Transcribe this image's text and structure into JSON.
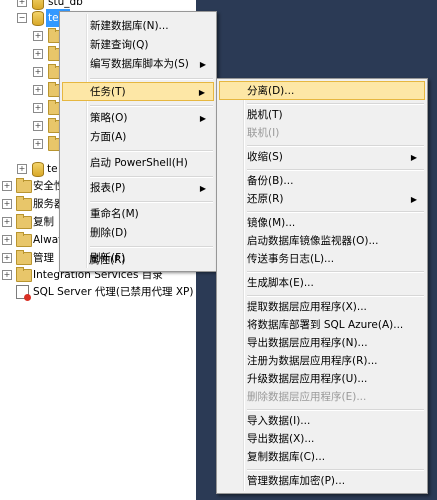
{
  "explorer": {
    "top_db": "stu_db",
    "selected_db": "test",
    "second_db": "te",
    "top_folders": [
      "安全性",
      "服务器",
      "复制",
      "Always",
      "管理",
      "Integration Services 目录"
    ],
    "agent": "SQL Server 代理(已禁用代理 XP)"
  },
  "context_menu": {
    "items": [
      {
        "label": "新建数据库(N)...",
        "arrow": false
      },
      {
        "label": "新建查询(Q)",
        "arrow": false
      },
      {
        "label": "编写数据库脚本为(S)",
        "arrow": true
      },
      {
        "label": "任务(T)",
        "arrow": true
      },
      {
        "label": "策略(O)",
        "arrow": true
      },
      {
        "label": "方面(A)",
        "arrow": false
      },
      {
        "label": "启动 PowerShell(H)",
        "arrow": false
      },
      {
        "label": "报表(P)",
        "arrow": true
      },
      {
        "label": "重命名(M)",
        "arrow": false
      },
      {
        "label": "删除(D)",
        "arrow": false
      },
      {
        "label": "刷新(F)",
        "arrow": false
      },
      {
        "label": "属性(R)",
        "arrow": false
      }
    ]
  },
  "tasks_submenu": {
    "items": [
      {
        "label": "分离(D)...",
        "arrow": false,
        "disabled": false
      },
      {
        "label": "脱机(T)",
        "arrow": false,
        "disabled": false
      },
      {
        "label": "联机(I)",
        "arrow": false,
        "disabled": true
      },
      {
        "label": "收缩(S)",
        "arrow": true,
        "disabled": false
      },
      {
        "label": "备份(B)...",
        "arrow": false,
        "disabled": false
      },
      {
        "label": "还原(R)",
        "arrow": true,
        "disabled": false
      },
      {
        "label": "镜像(M)...",
        "arrow": false,
        "disabled": false
      },
      {
        "label": "启动数据库镜像监视器(O)...",
        "arrow": false,
        "disabled": false
      },
      {
        "label": "传送事务日志(L)...",
        "arrow": false,
        "disabled": false
      },
      {
        "label": "生成脚本(E)...",
        "arrow": false,
        "disabled": false
      },
      {
        "label": "提取数据层应用程序(X)...",
        "arrow": false,
        "disabled": false
      },
      {
        "label": "将数据库部署到 SQL Azure(A)...",
        "arrow": false,
        "disabled": false
      },
      {
        "label": "导出数据层应用程序(N)...",
        "arrow": false,
        "disabled": false
      },
      {
        "label": "注册为数据层应用程序(R)...",
        "arrow": false,
        "disabled": false
      },
      {
        "label": "升级数据层应用程序(U)...",
        "arrow": false,
        "disabled": false
      },
      {
        "label": "删除数据层应用程序(E)...",
        "arrow": false,
        "disabled": true
      },
      {
        "label": "导入数据(I)...",
        "arrow": false,
        "disabled": false
      },
      {
        "label": "导出数据(X)...",
        "arrow": false,
        "disabled": false
      },
      {
        "label": "复制数据库(C)...",
        "arrow": false,
        "disabled": false
      },
      {
        "label": "管理数据库加密(P)...",
        "arrow": false,
        "disabled": false
      }
    ]
  },
  "colors": {
    "background": "#2b3a55",
    "highlight": "#fde7a6",
    "selection": "#3399ff"
  }
}
